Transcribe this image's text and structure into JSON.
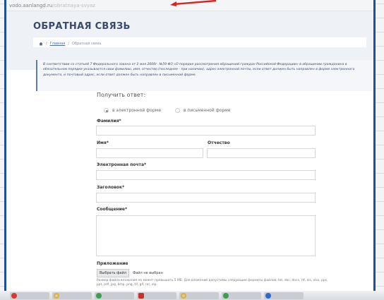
{
  "url": {
    "host": "vodo.aanlangd.ru",
    "path": "/obratnaya-svyaz"
  },
  "page": {
    "title": "ОБРАТНАЯ СВЯЗЬ",
    "breadcrumb": {
      "home": "Главная",
      "separator": "/",
      "current": "Обратная связь"
    },
    "notice": "В соответствии со статьей 7 Федерального закона от 2 мая 2006г. №59-ФЗ «О порядке рассмотрения обращений граждан Российской Федерации» в обращении гражданина в обязательном порядке указывается свои фамилию, имя, отчество (последнее - при наличии), адрес электронной почты, если ответ должен быть направлен в форме электронного документа, и почтовый адрес, если ответ должен быть направлен в письменной форме."
  },
  "form": {
    "get_answer_label": "Получить ответ:",
    "radio_options": [
      {
        "label": "в электронной форме",
        "selected": true
      },
      {
        "label": "в письменной форме",
        "selected": false
      }
    ],
    "surname_label": "Фамилия*",
    "surname_value": "",
    "name_label": "Имя*",
    "name_value": "",
    "patronymic_label": "Отчество",
    "patronymic_value": "",
    "email_label": "Электронная почта*",
    "email_value": "",
    "subject_label": "Заголовок*",
    "subject_value": "",
    "message_label": "Сообщение*",
    "message_value": "",
    "attachment_label": "Приложение",
    "file_button": "Выбрать файл",
    "file_status": "Файл не выбран",
    "file_note": "Размер файла вложения не может превышать 5 МБ. Для вложений допустимы следующие форматы файлов: txt, doc, docx, rtf, xls, xlsx, pps, ppt, pdf, jpg, bmp, png, tif, gif, rar, zip."
  },
  "colors": {
    "window_border": "#1f4fa0",
    "title": "#3a4a6a",
    "notice_bar": "#5a7ab8",
    "arrow": "#e02020"
  },
  "taskbar": {
    "icons": [
      "red-circle",
      "yellow-ring",
      "green-leaf",
      "red-square",
      "yellow-ring",
      "green-leaf",
      "blue-ball"
    ]
  }
}
